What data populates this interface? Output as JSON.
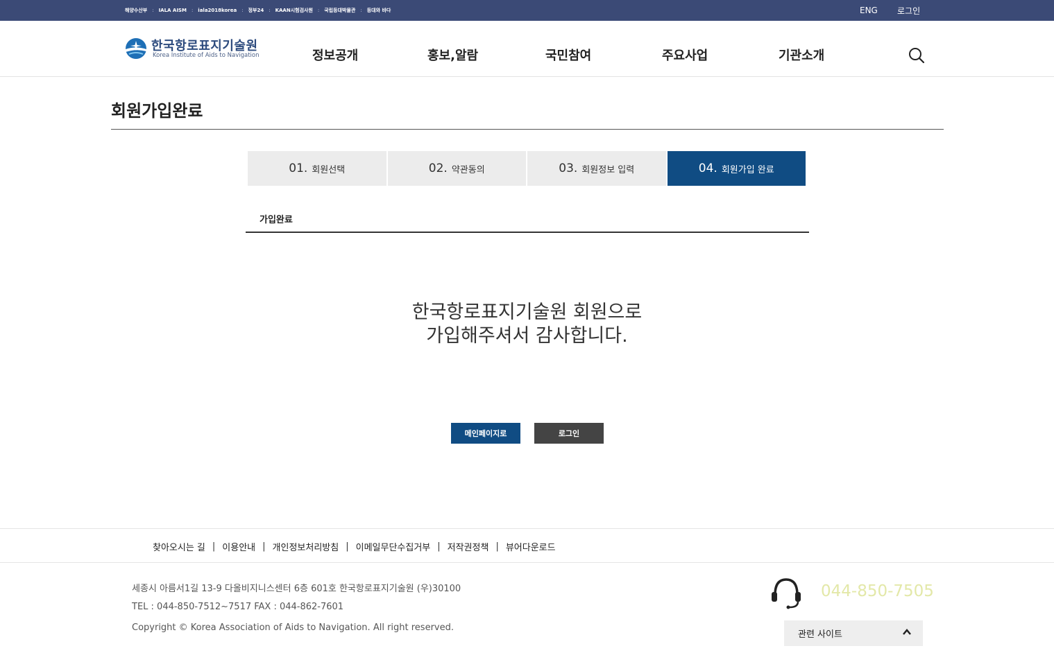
{
  "util": {
    "links": [
      "해양수산부",
      "IALA AISM",
      "iala2018korea",
      "정부24",
      "KAAN시험검사원",
      "국립등대박물관",
      "등대와 바다"
    ],
    "separator": ":",
    "eng": "ENG",
    "login": "로그인"
  },
  "header": {
    "logo_ko": "한국항로표지기술원",
    "logo_en": "Korea Institute of Aids to Navigation",
    "nav": [
      "정보공개",
      "홍보,알람",
      "국민참여",
      "주요사업",
      "기관소개"
    ]
  },
  "page": {
    "title": "회원가입완료"
  },
  "steps": [
    {
      "num": "01.",
      "label": "회원선택",
      "active": false
    },
    {
      "num": "02.",
      "label": "약관동의",
      "active": false
    },
    {
      "num": "03.",
      "label": "회원정보 입력",
      "active": false
    },
    {
      "num": "04.",
      "label": "회원가입 완료",
      "active": true
    }
  ],
  "section": {
    "subtitle": "가입완료",
    "message_line1": "한국항로표지기술원 회원으로",
    "message_line2": "가입해주셔서 감사합니다."
  },
  "buttons": {
    "main": "메인페이지로",
    "login": "로그인"
  },
  "footer": {
    "links": [
      "찾아오시는 길",
      "이용안내",
      "개인정보처리방침",
      "이메일무단수집거부",
      "저작권정책",
      "뷰어다운로드"
    ],
    "link_separator": "|",
    "address": "세종시 아름서1길 13-9 다올비지니스센터 6층 601호 한국항로표지기술원 (우)30100",
    "tel_fax": "TEL : 044-850-7512~7517 FAX : 044-862-7601",
    "copyright": "Copyright © Korea Association of Aids to Navigation. All right reserved.",
    "phone": "044-850-7505",
    "related": "관련 사이트"
  },
  "colors": {
    "util_bar": "#3b4a76",
    "primary": "#104c83",
    "dark_button": "#444444",
    "phone": "#e3e8a8"
  },
  "icons": [
    "search-icon",
    "headset-icon",
    "chevron-up-icon",
    "logo-icon"
  ]
}
